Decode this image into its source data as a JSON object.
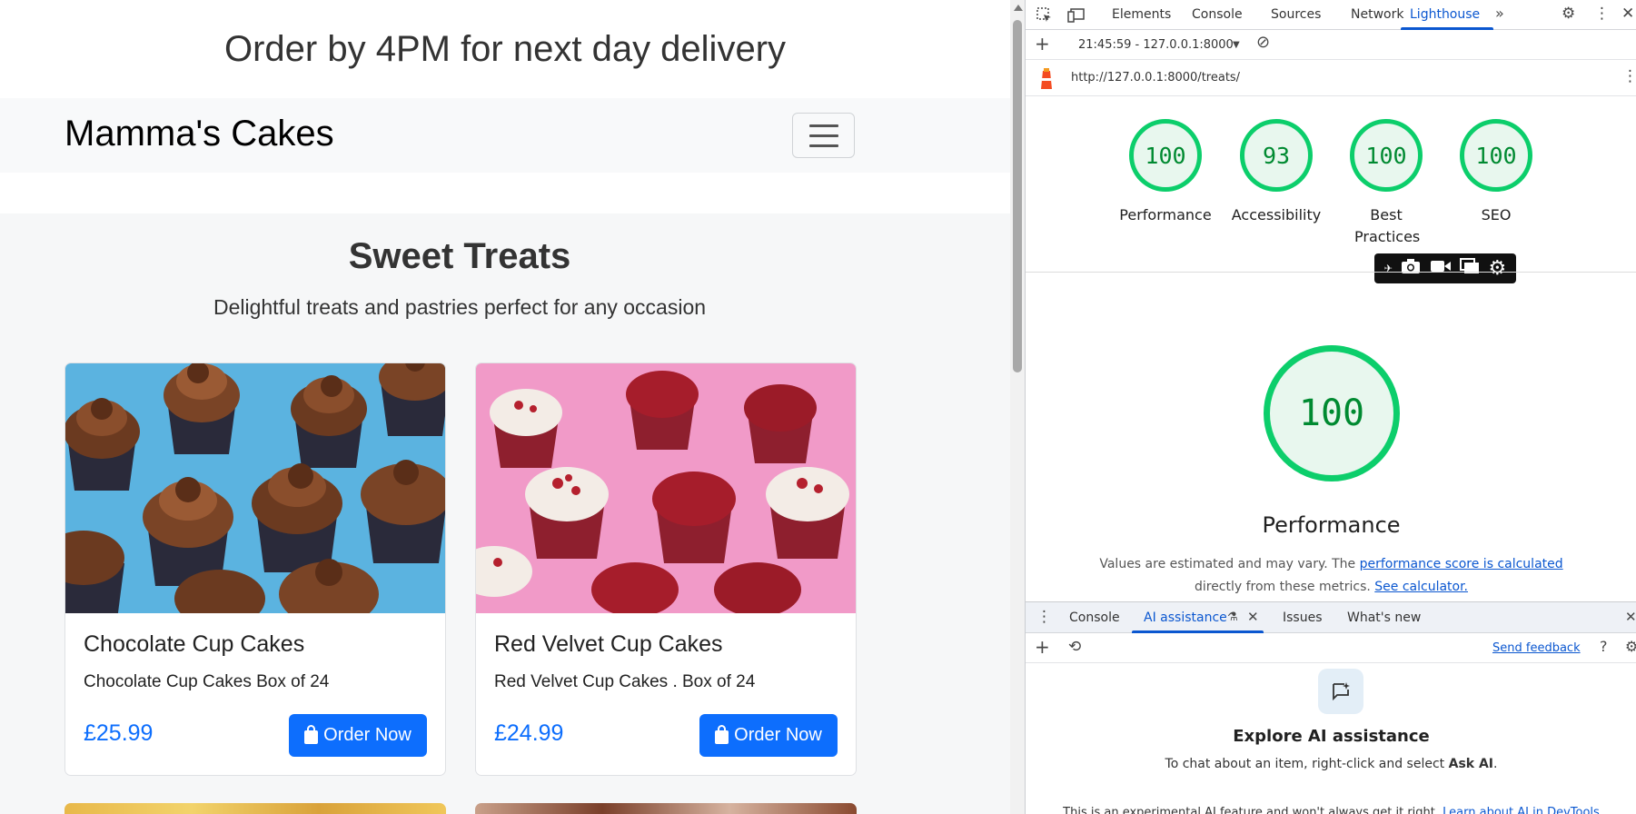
{
  "site": {
    "banner": "Order by 4PM for next day delivery",
    "brand": "Mamma's Cakes",
    "title": "Sweet Treats",
    "subtitle": "Delightful treats and pastries perfect for any occasion",
    "products": [
      {
        "name": "Chocolate Cup Cakes",
        "description": "Chocolate Cup Cakes Box of 24",
        "price": "£25.99",
        "button": "Order Now"
      },
      {
        "name": "Red Velvet Cup Cakes",
        "description": "Red Velvet Cup Cakes . Box of 24",
        "price": "£24.99",
        "button": "Order Now"
      }
    ]
  },
  "devtools": {
    "tabs": [
      "Elements",
      "Console",
      "Sources",
      "Network",
      "Lighthouse"
    ],
    "active_tab": "Lighthouse",
    "report_selector": "21:45:59 - 127.0.0.1:8000",
    "url": "http://127.0.0.1:8000/treats/",
    "scores": [
      {
        "label": "Performance",
        "value": "100"
      },
      {
        "label": "Accessibility",
        "value": "93"
      },
      {
        "label": "Best Practices",
        "value": "100"
      },
      {
        "label": "SEO",
        "value": "100"
      }
    ],
    "main_score": "100",
    "main_label": "Performance",
    "note_part1": "Values are estimated and may vary. The ",
    "note_link1": "performance score is calculated",
    "note_part2": "directly from these metrics.",
    "note_link2": "See calculator.",
    "drawer": {
      "tabs": [
        "Console",
        "AI assistance",
        "Issues",
        "What's new"
      ],
      "active_tab": "AI assistance",
      "send_feedback": "Send feedback",
      "ai_title": "Explore AI assistance",
      "ai_desc_prefix": "To chat about an item, right-click and select ",
      "ai_desc_bold": "Ask AI",
      "ai_desc_suffix": ".",
      "footer_text": "This is an experimental AI feature and won't always get it right. ",
      "footer_link": "Learn about AI in DevTools"
    }
  },
  "colors": {
    "accent": "#0d6efd",
    "score_green": "#0cce6b",
    "devtools_blue": "#0b57d0"
  }
}
